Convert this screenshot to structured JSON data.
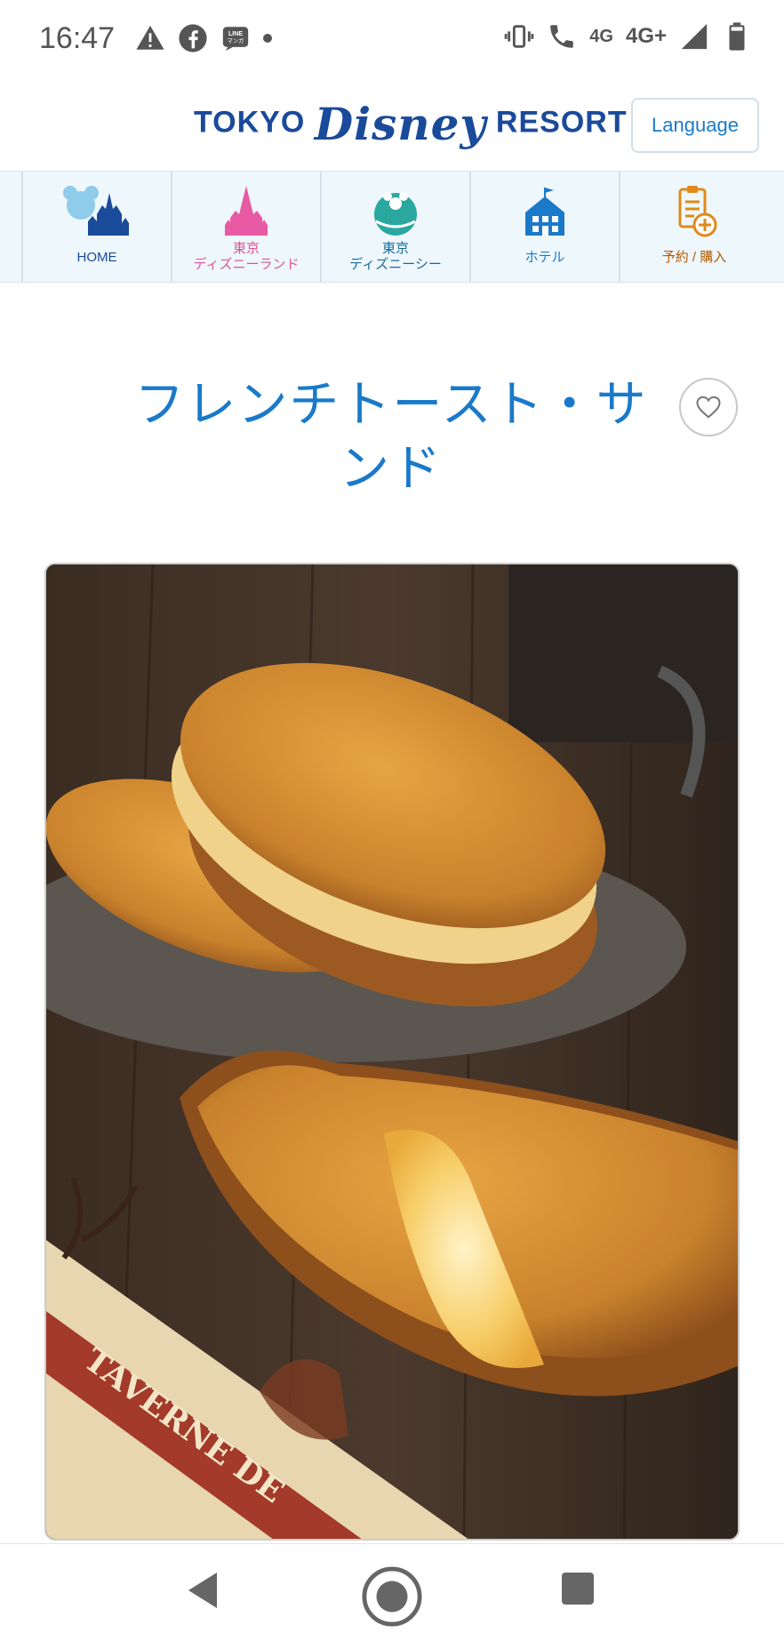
{
  "status_bar": {
    "time": "16:47",
    "network_4g": "4G",
    "network_4g_plus": "4G+"
  },
  "header": {
    "logo_tokyo": "TOKYO",
    "logo_disney": "Disney",
    "logo_resort": "RESORT",
    "logo_reg": "R",
    "language_button": "Language"
  },
  "nav": {
    "items": [
      {
        "label_line1": "HOME",
        "label_line2": "",
        "color": "#1a4a9a"
      },
      {
        "label_line1": "東京",
        "label_line2": "ディズニーランド",
        "color": "#e0529a"
      },
      {
        "label_line1": "東京",
        "label_line2": "ディズニーシー",
        "color": "#1a6a9a"
      },
      {
        "label_line1": "ホテル",
        "label_line2": "",
        "color": "#1a7ac9"
      },
      {
        "label_line1": "予約 / 購入",
        "label_line2": "",
        "color": "#b35a00"
      }
    ]
  },
  "page": {
    "title_line1": "フレンチトースト・サ",
    "title_line2": "ンド",
    "title_color": "#1a7ac9"
  },
  "photo": {
    "alt": "フレンチトースト・サンド",
    "paper_text": "TAVERNE DE"
  },
  "icons": {
    "favorite": "heart-icon",
    "back": "back-icon",
    "home": "home-icon",
    "recents": "recents-icon"
  }
}
